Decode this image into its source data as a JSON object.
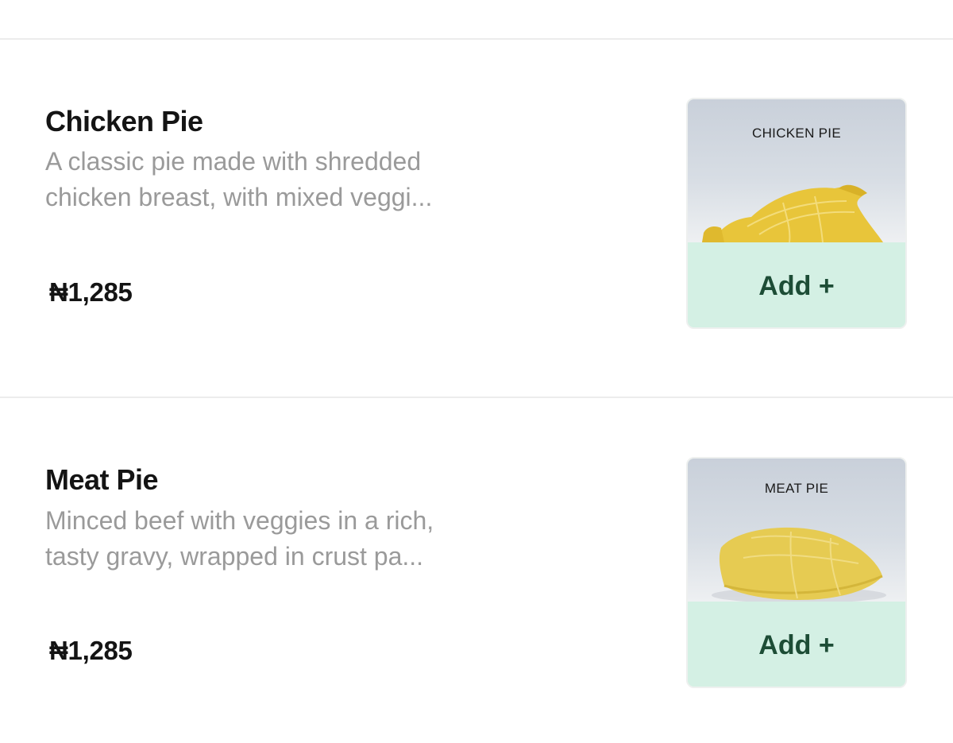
{
  "menu": {
    "items": [
      {
        "name": "Chicken Pie",
        "description_lines": [
          "A classic pie made with shredded",
          "chicken breast, with mixed veggi..."
        ],
        "price": "₦1,285",
        "photo_label": "CHICKEN PIE",
        "add_label": "Add +"
      },
      {
        "name": "Meat Pie",
        "description_lines": [
          "Minced beef with veggies in a rich,",
          "tasty gravy, wrapped in crust pa..."
        ],
        "price": "₦1,285",
        "photo_label": "MEAT PIE",
        "add_label": "Add +"
      }
    ]
  },
  "colors": {
    "add_button_bg": "#d4f0e4",
    "add_button_text": "#1d4d36",
    "description_text": "#9a9a9a",
    "title_text": "#141414",
    "pastry": "#e8c53a"
  }
}
